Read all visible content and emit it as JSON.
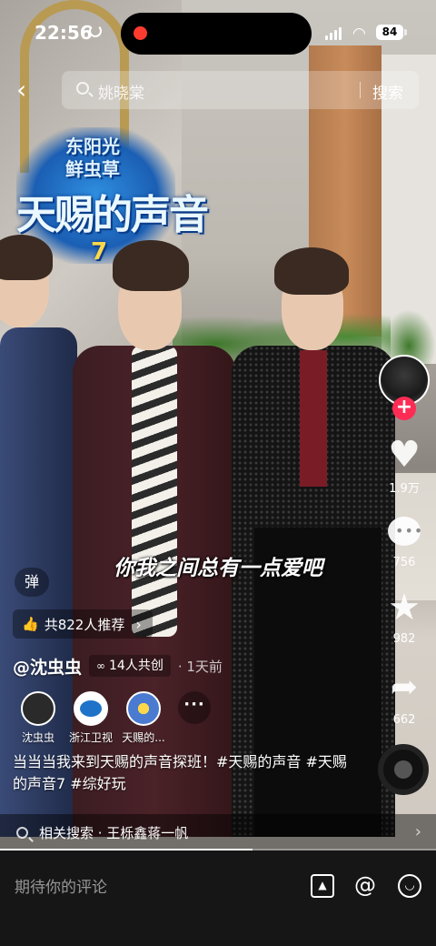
{
  "status_bar": {
    "time": "22:56",
    "battery": "84"
  },
  "search": {
    "query": "姚晓棠",
    "button": "搜索"
  },
  "video": {
    "logo_lines": [
      "东阳光",
      "鲜虫草",
      "天赐的声音",
      "7"
    ],
    "subtitle": "你我之间总有一点爱吧",
    "progress": 0.58
  },
  "rail": {
    "likes": "1.9万",
    "comments": "756",
    "favorites": "982",
    "shares": "662"
  },
  "overlay": {
    "danmaku": "弹",
    "recommend": "共822人推荐",
    "author": "@沈虫虫",
    "cocreate": "14人共创",
    "time_ago": "· 1天前",
    "coauthors": [
      {
        "name": "沈虫虫",
        "color": "#2a2a2a"
      },
      {
        "name": "浙江卫视",
        "color": "#1e73c8"
      },
      {
        "name": "天赐的...",
        "color": "#4a7bd0"
      }
    ],
    "caption": "当当当我来到天赐的声音探班！#天赐的声音 #天赐的声音7 #综好玩",
    "related": "相关搜索 · 王栎鑫蒋一帆"
  },
  "comment_bar": {
    "placeholder": "期待你的评论"
  },
  "colors": {
    "accent": "#fe2c55",
    "bar_bg": "#161616"
  }
}
